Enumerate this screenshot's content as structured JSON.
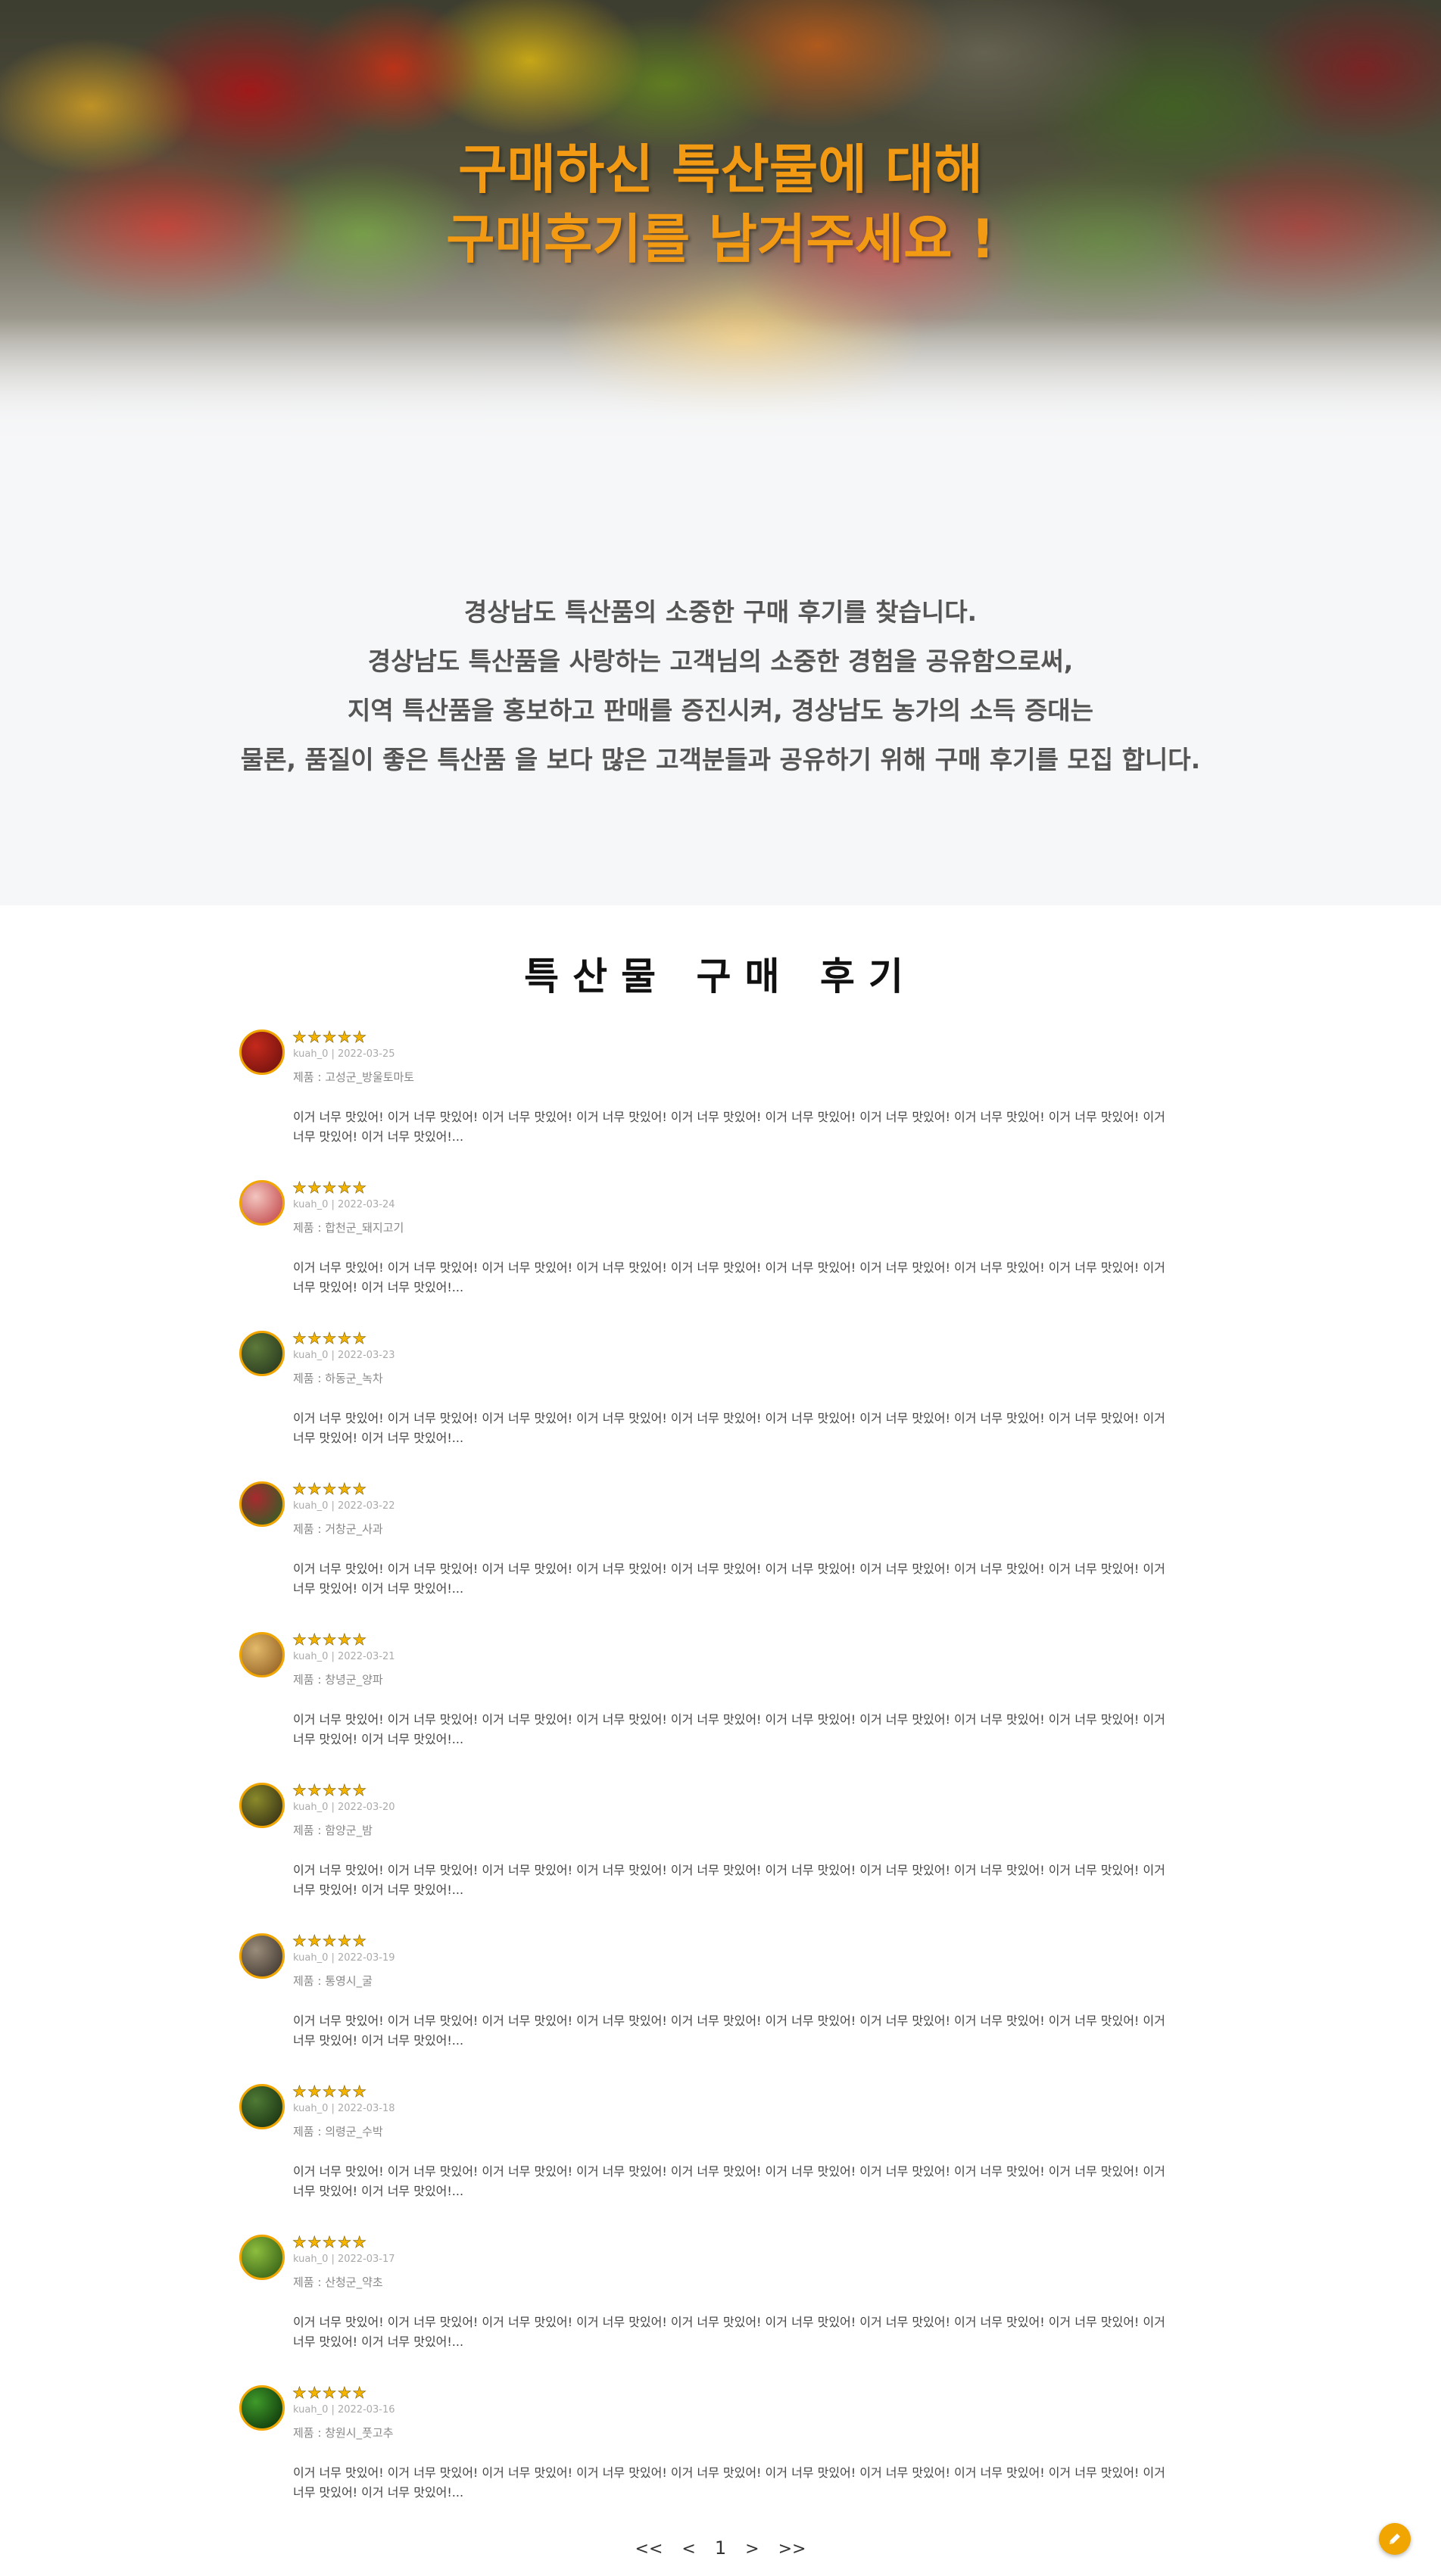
{
  "hero": {
    "title_line1": "구매하신 특산물에 대해",
    "title_line2": "구매후기를 남겨주세요 !"
  },
  "intro": {
    "lines": [
      "경상남도 특산품의 소중한 구매 후기를 찾습니다.",
      "경상남도 특산품을 사랑하는 고객님의 소중한 경험을 공유함으로써,",
      "지역 특산품을 홍보하고 판매를 증진시켜, 경상남도 농가의 소득 증대는",
      "물론, 품질이 좋은 특산품 을 보다 많은 고객분들과 공유하기 위해 구매 후기를 모집 합니다."
    ]
  },
  "reviews_section": {
    "title": "특산물 구매 후기"
  },
  "reviews": [
    {
      "stars": "★★★★★",
      "meta": "kuah_0 | 2022-03-25",
      "product": "제품 : 고성군_방울토마토",
      "body": "이거 너무 맛있어! 이거 너무 맛있어! 이거 너무 맛있어! 이거 너무 맛있어! 이거 너무 맛있어! 이거 너무 맛있어! 이거 너무 맛있어! 이거 너무 맛있어! 이거 너무 맛있어! 이거 너무 맛있어! 이거 너무 맛있어!...",
      "avatar_colors": [
        "#c42a1c",
        "#7a1410"
      ],
      "avatar_icon": "cherry-tomato-icon"
    },
    {
      "stars": "★★★★★",
      "meta": "kuah_0 | 2022-03-24",
      "product": "제품 : 합천군_돼지고기",
      "body": "이거 너무 맛있어! 이거 너무 맛있어! 이거 너무 맛있어! 이거 너무 맛있어! 이거 너무 맛있어! 이거 너무 맛있어! 이거 너무 맛있어! 이거 너무 맛있어! 이거 너무 맛있어! 이거 너무 맛있어! 이거 너무 맛있어!...",
      "avatar_colors": [
        "#f3c5bf",
        "#c9585a"
      ],
      "avatar_icon": "pork-icon"
    },
    {
      "stars": "★★★★★",
      "meta": "kuah_0 | 2022-03-23",
      "product": "제품 : 하동군_녹차",
      "body": "이거 너무 맛있어! 이거 너무 맛있어! 이거 너무 맛있어! 이거 너무 맛있어! 이거 너무 맛있어! 이거 너무 맛있어! 이거 너무 맛있어! 이거 너무 맛있어! 이거 너무 맛있어! 이거 너무 맛있어! 이거 너무 맛있어!...",
      "avatar_colors": [
        "#5d7a3a",
        "#2e3f22"
      ],
      "avatar_icon": "green-tea-icon"
    },
    {
      "stars": "★★★★★",
      "meta": "kuah_0 | 2022-03-22",
      "product": "제품 : 거창군_사과",
      "body": "이거 너무 맛있어! 이거 너무 맛있어! 이거 너무 맛있어! 이거 너무 맛있어! 이거 너무 맛있어! 이거 너무 맛있어! 이거 너무 맛있어! 이거 너무 맛있어! 이거 너무 맛있어! 이거 너무 맛있어! 이거 너무 맛있어!...",
      "avatar_colors": [
        "#a82a2f",
        "#3e5a27"
      ],
      "avatar_icon": "apple-icon"
    },
    {
      "stars": "★★★★★",
      "meta": "kuah_0 | 2022-03-21",
      "product": "제품 : 창녕군_양파",
      "body": "이거 너무 맛있어! 이거 너무 맛있어! 이거 너무 맛있어! 이거 너무 맛있어! 이거 너무 맛있어! 이거 너무 맛있어! 이거 너무 맛있어! 이거 너무 맛있어! 이거 너무 맛있어! 이거 너무 맛있어! 이거 너무 맛있어!...",
      "avatar_colors": [
        "#e2b96a",
        "#9c6a2b"
      ],
      "avatar_icon": "onion-icon"
    },
    {
      "stars": "★★★★★",
      "meta": "kuah_0 | 2022-03-20",
      "product": "제품 : 함양군_밤",
      "body": "이거 너무 맛있어! 이거 너무 맛있어! 이거 너무 맛있어! 이거 너무 맛있어! 이거 너무 맛있어! 이거 너무 맛있어! 이거 너무 맛있어! 이거 너무 맛있어! 이거 너무 맛있어! 이거 너무 맛있어! 이거 너무 맛있어!...",
      "avatar_colors": [
        "#8a8a2a",
        "#3f3a18"
      ],
      "avatar_icon": "chestnut-icon"
    },
    {
      "stars": "★★★★★",
      "meta": "kuah_0 | 2022-03-19",
      "product": "제품 : 통영시_굴",
      "body": "이거 너무 맛있어! 이거 너무 맛있어! 이거 너무 맛있어! 이거 너무 맛있어! 이거 너무 맛있어! 이거 너무 맛있어! 이거 너무 맛있어! 이거 너무 맛있어! 이거 너무 맛있어! 이거 너무 맛있어! 이거 너무 맛있어!...",
      "avatar_colors": [
        "#9a8c7a",
        "#4a4038"
      ],
      "avatar_icon": "oyster-icon"
    },
    {
      "stars": "★★★★★",
      "meta": "kuah_0 | 2022-03-18",
      "product": "제품 : 의령군_수박",
      "body": "이거 너무 맛있어! 이거 너무 맛있어! 이거 너무 맛있어! 이거 너무 맛있어! 이거 너무 맛있어! 이거 너무 맛있어! 이거 너무 맛있어! 이거 너무 맛있어! 이거 너무 맛있어! 이거 너무 맛있어! 이거 너무 맛있어!...",
      "avatar_colors": [
        "#4f7a35",
        "#1f3a16"
      ],
      "avatar_icon": "watermelon-icon"
    },
    {
      "stars": "★★★★★",
      "meta": "kuah_0 | 2022-03-17",
      "product": "제품 : 산청군_약초",
      "body": "이거 너무 맛있어! 이거 너무 맛있어! 이거 너무 맛있어! 이거 너무 맛있어! 이거 너무 맛있어! 이거 너무 맛있어! 이거 너무 맛있어! 이거 너무 맛있어! 이거 너무 맛있어! 이거 너무 맛있어! 이거 너무 맛있어!...",
      "avatar_colors": [
        "#8dbd3e",
        "#3f6a1a"
      ],
      "avatar_icon": "herb-icon"
    },
    {
      "stars": "★★★★★",
      "meta": "kuah_0 | 2022-03-16",
      "product": "제품 : 창원시_풋고추",
      "body": "이거 너무 맛있어! 이거 너무 맛있어! 이거 너무 맛있어! 이거 너무 맛있어! 이거 너무 맛있어! 이거 너무 맛있어! 이거 너무 맛있어! 이거 너무 맛있어! 이거 너무 맛있어! 이거 너무 맛있어! 이거 너무 맛있어!...",
      "avatar_colors": [
        "#3f9a2a",
        "#13400e"
      ],
      "avatar_icon": "green-pepper-icon"
    }
  ],
  "pagination": {
    "first": "<<",
    "prev": "<",
    "current": "1",
    "next": ">",
    "last": ">>"
  },
  "fab": {
    "icon": "pencil-icon",
    "color": "#f0a500"
  },
  "colors": {
    "accent": "#f39a14",
    "star": "#f5b400"
  }
}
